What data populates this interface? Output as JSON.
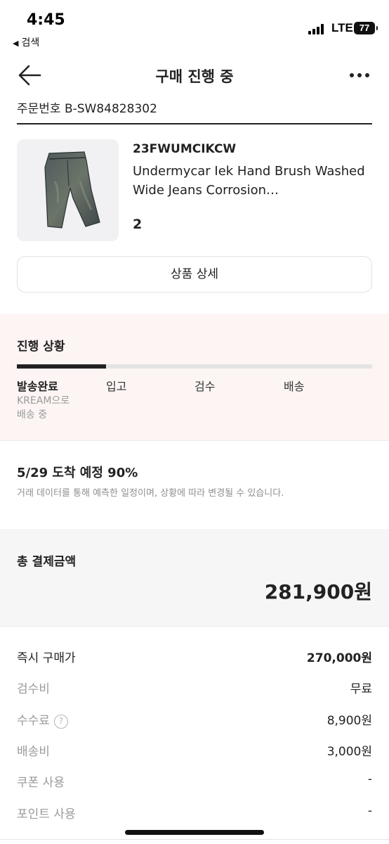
{
  "status_bar": {
    "time": "4:45",
    "back_app": "검색",
    "network": "LTE",
    "battery": "77"
  },
  "nav": {
    "title": "구매 진행 중"
  },
  "order": {
    "number": "주문번호 B-SW84828302"
  },
  "product": {
    "code": "23FWUMCIKCW",
    "name": "Undermycar Iek Hand Brush Washed Wide Jeans Corrosion…",
    "size": "2",
    "detail_button": "상품 상세"
  },
  "progress": {
    "title": "진행 상황",
    "fill_fraction": 0.25,
    "steps": [
      "발송완료",
      "입고",
      "검수",
      "배송"
    ],
    "active_sub": [
      "KREAM으로",
      "배송 중"
    ]
  },
  "arrival": {
    "headline": "5/29 도착 예정 90%",
    "note": "거래 데이터를 통해 예측한 일정이며, 상황에 따라 변경될 수 있습니다."
  },
  "total": {
    "label": "총 결제금액",
    "value": "281,900원"
  },
  "fees": [
    {
      "label": "즉시 구매가",
      "value": "270,000원"
    },
    {
      "label": "검수비",
      "value": "무료"
    },
    {
      "label": "수수료",
      "value": "8,900원"
    },
    {
      "label": "배송비",
      "value": "3,000원"
    },
    {
      "label": "쿠폰 사용",
      "value": "-"
    },
    {
      "label": "포인트 사용",
      "value": "-"
    }
  ],
  "icons": {
    "back": "arrow-left-icon",
    "more": "more-dots-icon",
    "help": "question-circle-icon",
    "help_glyph": "?"
  }
}
